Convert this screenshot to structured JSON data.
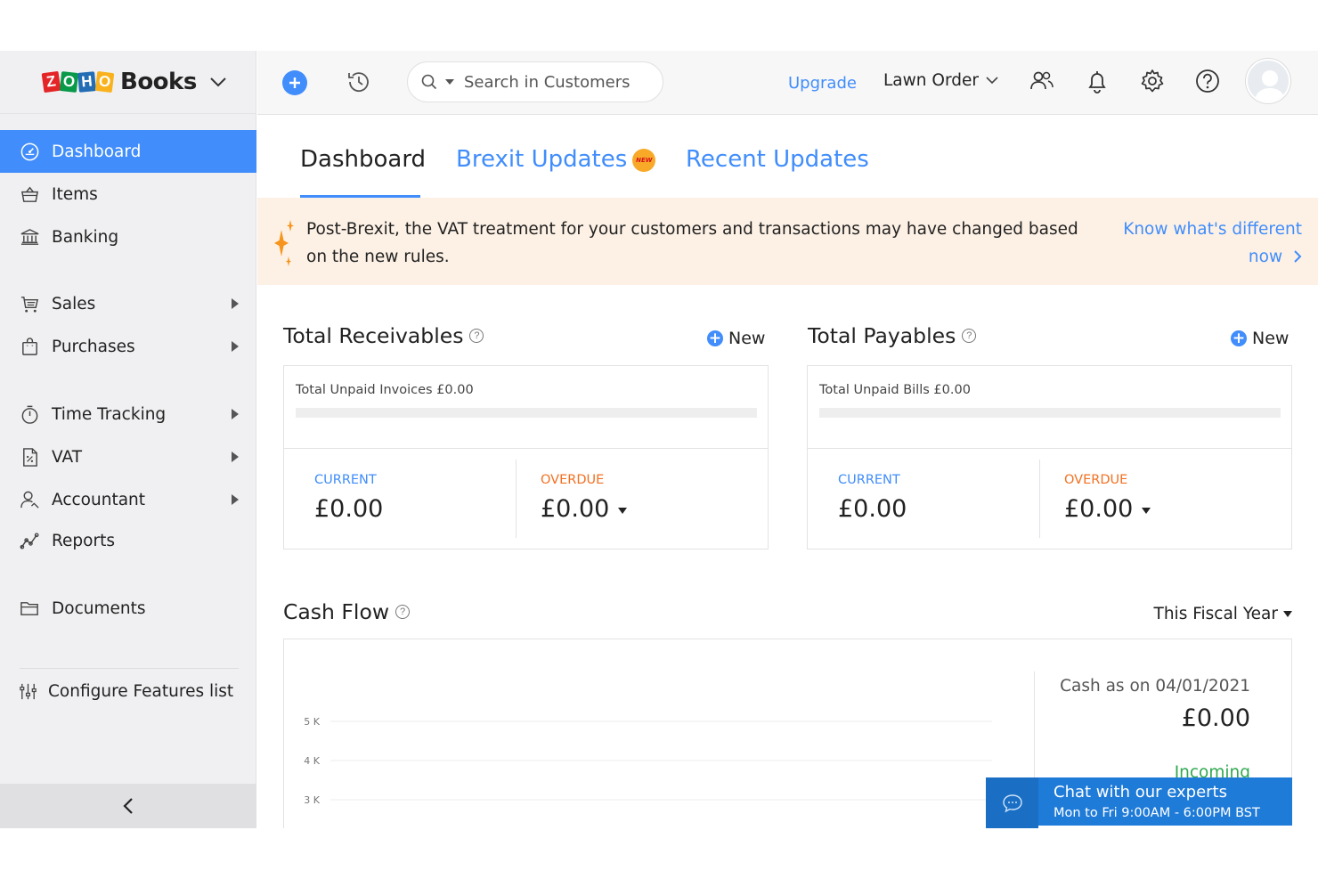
{
  "app": {
    "brand": "Books",
    "logo_letters": [
      "Z",
      "O",
      "H",
      "O"
    ]
  },
  "sidebar": {
    "items": [
      {
        "label": "Dashboard",
        "icon": "dashboard-icon",
        "active": true,
        "has_submenu": false
      },
      {
        "label": "Items",
        "icon": "basket-icon",
        "active": false,
        "has_submenu": false
      },
      {
        "label": "Banking",
        "icon": "bank-icon",
        "active": false,
        "has_submenu": false
      },
      {
        "label": "Sales",
        "icon": "cart-icon",
        "active": false,
        "has_submenu": true
      },
      {
        "label": "Purchases",
        "icon": "bag-icon",
        "active": false,
        "has_submenu": true
      },
      {
        "label": "Time Tracking",
        "icon": "stopwatch-icon",
        "active": false,
        "has_submenu": true
      },
      {
        "label": "VAT",
        "icon": "tax-document-icon",
        "active": false,
        "has_submenu": true
      },
      {
        "label": "Accountant",
        "icon": "accountant-icon",
        "active": false,
        "has_submenu": true
      },
      {
        "label": "Reports",
        "icon": "reports-icon",
        "active": false,
        "has_submenu": false
      },
      {
        "label": "Documents",
        "icon": "folder-icon",
        "active": false,
        "has_submenu": false
      }
    ],
    "configure_label": "Configure Features list"
  },
  "header": {
    "search_placeholder": "Search in Customers",
    "upgrade_label": "Upgrade",
    "org_name": "Lawn Order"
  },
  "tabs": [
    {
      "label": "Dashboard",
      "active": true
    },
    {
      "label": "Brexit Updates",
      "active": false,
      "badge": "NEW"
    },
    {
      "label": "Recent Updates",
      "active": false
    }
  ],
  "banner": {
    "text": "Post-Brexit, the VAT treatment for your customers and transactions may have changed based on the new rules.",
    "link_label": "Know what's different now"
  },
  "receivables": {
    "title": "Total Receivables",
    "new_label": "New",
    "unpaid_label": "Total Unpaid Invoices £0.00",
    "unpaid_fraction": 0,
    "current_label": "CURRENT",
    "current_value": "£0.00",
    "overdue_label": "OVERDUE",
    "overdue_value": "£0.00"
  },
  "payables": {
    "title": "Total Payables",
    "new_label": "New",
    "unpaid_label": "Total Unpaid Bills £0.00",
    "unpaid_fraction": 0,
    "current_label": "CURRENT",
    "current_value": "£0.00",
    "overdue_label": "OVERDUE",
    "overdue_value": "£0.00"
  },
  "cashflow": {
    "title": "Cash Flow",
    "period_label": "This Fiscal Year",
    "cash_label": "Cash as on 04/01/2021",
    "cash_value": "£0.00",
    "incoming_label": "Incoming"
  },
  "chart_data": {
    "type": "line",
    "title": "",
    "xlabel": "",
    "ylabel": "",
    "y_ticks": [
      "5 K",
      "4 K",
      "3 K"
    ],
    "grid": true,
    "series": []
  },
  "chat": {
    "title": "Chat with our experts",
    "hours": "Mon to Fri 9:00AM - 6:00PM BST"
  },
  "colors": {
    "accent": "#408dfb",
    "overdue": "#f37021",
    "banner_bg": "#fdf1e5",
    "chat_bg": "#1f7bd8",
    "incoming": "#2fa84f"
  }
}
